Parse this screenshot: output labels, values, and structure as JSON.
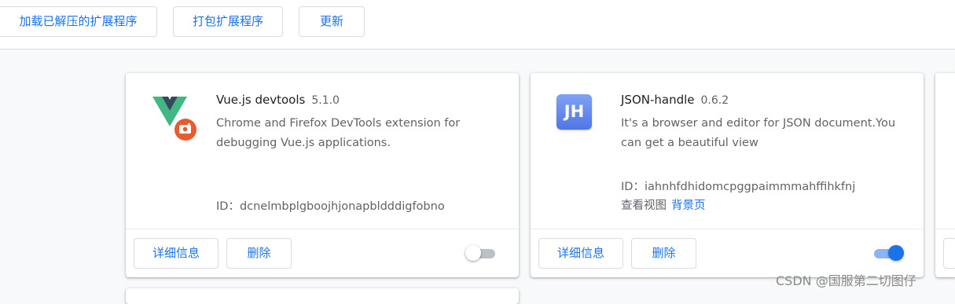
{
  "toolbar": {
    "load_unpacked": "加载已解压的扩展程序",
    "pack": "打包扩展程序",
    "update": "更新"
  },
  "extensions": [
    {
      "name": "Vue.js devtools",
      "version": "5.1.0",
      "description": "Chrome and Firefox DevTools extension for debugging Vue.js applications.",
      "id": "ID：dcnelmbplgboojhjonapbldddigfobno",
      "details_label": "详细信息",
      "remove_label": "删除",
      "enabled": false,
      "icon": "vue-logo-icon"
    },
    {
      "name": "JSON-handle",
      "version": "0.6.2",
      "description": "It's a browser and editor for JSON document.You can get a beautiful view",
      "id": "ID：iahnhfdhidomcpggpaimmmahffihkfnj",
      "inspect_label": "查看视图",
      "background_page": "背景页",
      "details_label": "详细信息",
      "remove_label": "删除",
      "enabled": true,
      "icon": "jh-logo-icon",
      "icon_text": "JH"
    }
  ],
  "watermark": "CSDN @国服第二切图仔",
  "colors": {
    "accent": "#1a73e8",
    "vue_green": "#41b883",
    "vue_dark": "#35495e",
    "badge_orange": "#ea5a2d"
  }
}
